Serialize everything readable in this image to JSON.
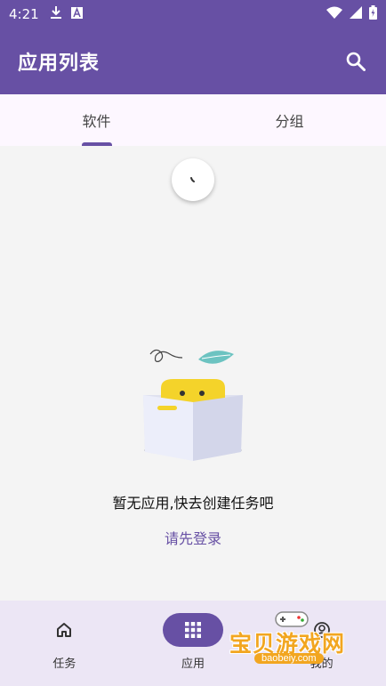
{
  "status_bar": {
    "time": "4:21",
    "icons": [
      "download-icon",
      "a-text-icon",
      "wifi-icon",
      "signal-icon",
      "battery-icon"
    ]
  },
  "app_bar": {
    "title": "应用列表",
    "search_icon": "search-icon"
  },
  "tabs": [
    {
      "label": "软件",
      "active": true
    },
    {
      "label": "分组",
      "active": false
    }
  ],
  "empty_state": {
    "message": "暂无应用,快去创建任务吧",
    "login_link": "请先登录"
  },
  "bottom_nav": [
    {
      "label": "任务",
      "icon": "home-icon",
      "active": false
    },
    {
      "label": "应用",
      "icon": "grid-icon",
      "active": true
    },
    {
      "label": "我的",
      "icon": "profile-icon",
      "active": false
    }
  ],
  "watermark": {
    "text": "宝贝游戏网",
    "url": "baobeiy.com"
  },
  "colors": {
    "primary": "#6750a4",
    "tab_bg": "#fdf7ff",
    "nav_bg": "#ece6f5",
    "content_bg": "#f4f4f4"
  }
}
